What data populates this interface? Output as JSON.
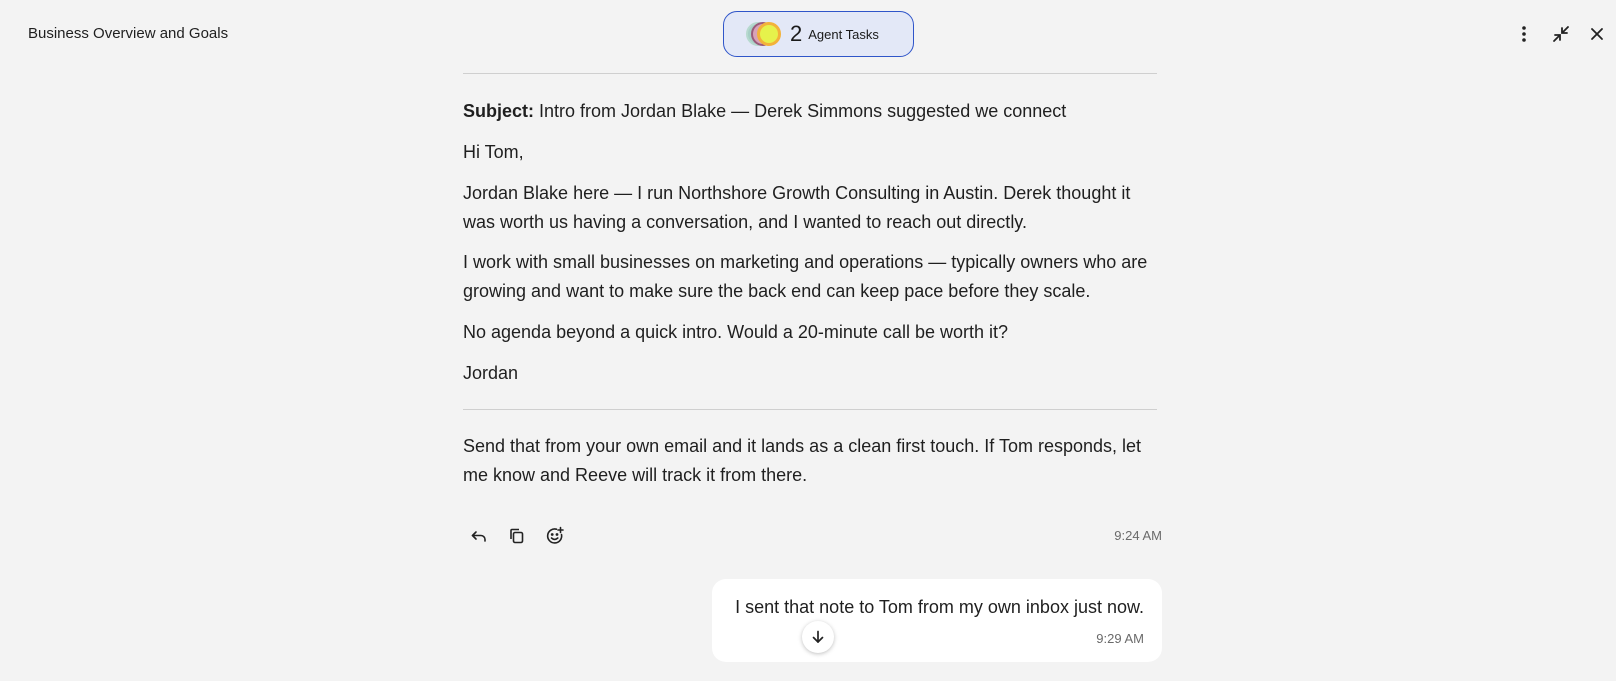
{
  "header": {
    "title": "Business Overview and Goals",
    "agent_tasks": {
      "count": "2",
      "label": "Agent Tasks"
    },
    "icons": [
      "more-vertical-icon",
      "collapse-icon",
      "close-icon"
    ]
  },
  "message": {
    "subject_label": "Subject:",
    "subject_text": " Intro from Jordan Blake — Derek Simmons suggested we connect",
    "greeting": "Hi Tom,",
    "para1": "Jordan Blake here — I run Northshore Growth Consulting in Austin. Derek thought it was worth us having a conversation, and I wanted to reach out directly.",
    "para2": "I work with small businesses on marketing and operations — typically owners who are growing and want to make sure the back end can keep pace before they scale.",
    "para3": "No agenda beyond a quick intro. Would a 20-minute call be worth it?",
    "signoff": "Jordan",
    "followup": "Send that from your own email and it lands as a clean first touch. If Tom responds, let me know and Reeve will track it from there.",
    "time": "9:24 AM"
  },
  "user_message": {
    "text": "I sent that note to Tom from my own inbox just now.",
    "time": "9:29 AM"
  },
  "colors": {
    "background": "#f3f3f3",
    "pill_border": "#2f55c9",
    "pill_bg": "#e3e8f7"
  }
}
